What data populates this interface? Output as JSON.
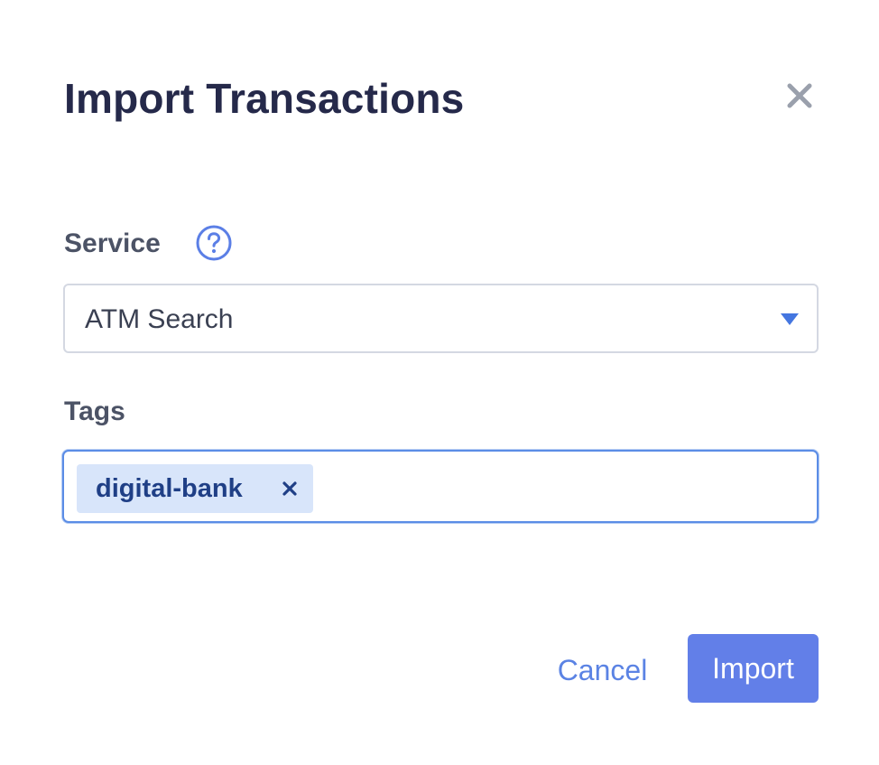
{
  "dialog": {
    "title": "Import Transactions",
    "close_icon": "close-icon"
  },
  "service": {
    "label": "Service",
    "help_icon": "question-circle-icon",
    "selected": "ATM Search",
    "caret_icon": "caret-down-icon"
  },
  "tags": {
    "label": "Tags",
    "items": [
      {
        "label": "digital-bank",
        "remove_icon": "close-icon"
      }
    ]
  },
  "footer": {
    "cancel_label": "Cancel",
    "import_label": "Import"
  },
  "colors": {
    "accent": "#627fe8",
    "link": "#5b83e4",
    "title": "#25294a",
    "label": "#4c5366",
    "tag_bg": "#d8e5fa",
    "tag_text": "#1f3f86",
    "focus_border": "#5b8de6"
  }
}
